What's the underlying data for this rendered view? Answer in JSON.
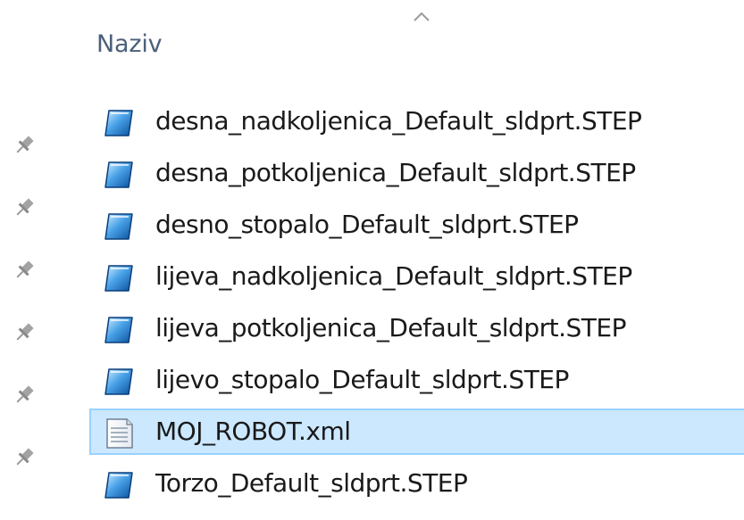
{
  "header": {
    "column_name": "Naziv"
  },
  "icons": {
    "sort": "chevron-up-icon",
    "pin": "pin-icon",
    "step_file": "solidworks-part-icon",
    "xml_file": "xml-document-icon"
  },
  "colors": {
    "selection_bg": "#cce8ff",
    "selection_border": "#99d1ff",
    "header_text": "#4c607a"
  },
  "files": [
    {
      "name": "desna_nadkoljenica_Default_sldprt.STEP",
      "type": "step",
      "selected": false
    },
    {
      "name": "desna_potkoljenica_Default_sldprt.STEP",
      "type": "step",
      "selected": false
    },
    {
      "name": "desno_stopalo_Default_sldprt.STEP",
      "type": "step",
      "selected": false
    },
    {
      "name": "lijeva_nadkoljenica_Default_sldprt.STEP",
      "type": "step",
      "selected": false
    },
    {
      "name": "lijeva_potkoljenica_Default_sldprt.STEP",
      "type": "step",
      "selected": false
    },
    {
      "name": "lijevo_stopalo_Default_sldprt.STEP",
      "type": "step",
      "selected": false
    },
    {
      "name": "MOJ_ROBOT.xml",
      "type": "xml",
      "selected": true
    },
    {
      "name": "Torzo_Default_sldprt.STEP",
      "type": "step",
      "selected": false
    }
  ]
}
